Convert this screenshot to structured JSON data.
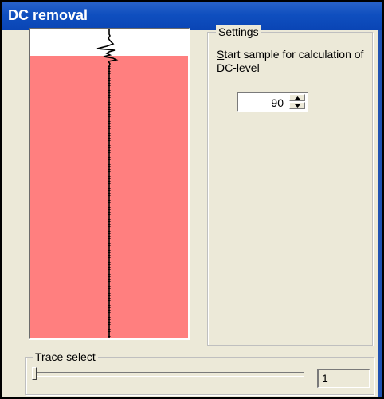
{
  "window": {
    "title": "DC removal"
  },
  "settings": {
    "legend": "Settings",
    "description_mnemonic": "S",
    "description_rest": "tart sample for calculation of DC-level",
    "start_sample_value": "90"
  },
  "trace": {
    "legend": "Trace select",
    "value": "1",
    "slider_position": 0
  },
  "preview": {
    "background_color": "#ff7f7f",
    "top_band_color": "#ffffff",
    "trace_color": "#000000"
  },
  "colors": {
    "titlebar": "#0f4fbf",
    "dialog_bg": "#ece9d8"
  }
}
